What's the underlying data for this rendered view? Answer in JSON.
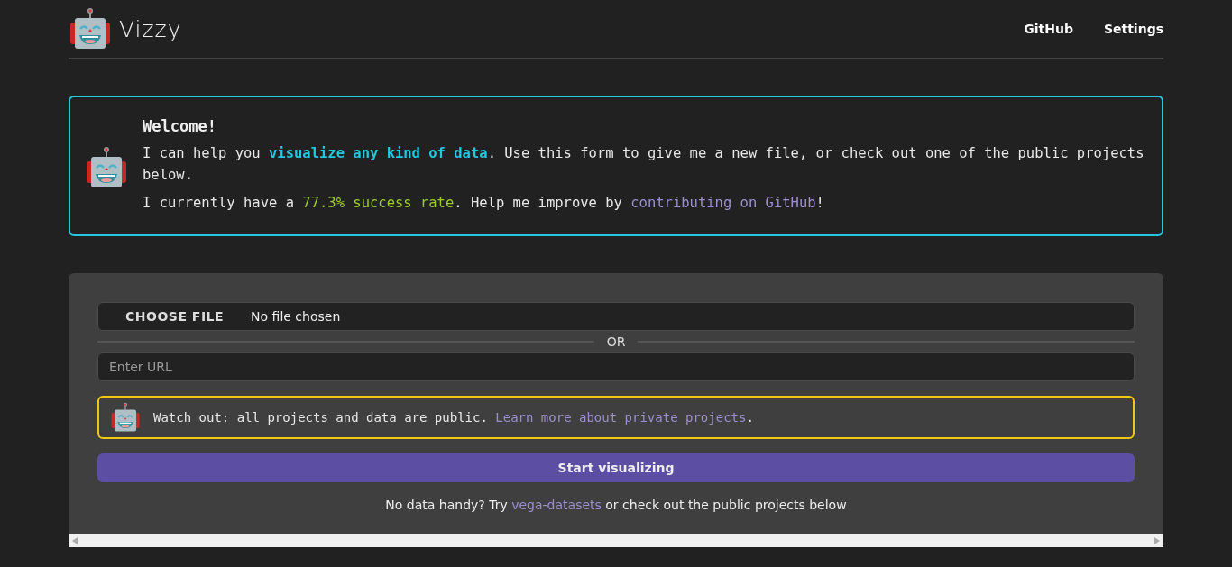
{
  "header": {
    "brand": "Vizzy",
    "nav": [
      "GitHub",
      "Settings"
    ]
  },
  "welcome": {
    "title": "Welcome!",
    "paragraphs": [
      [
        {
          "kind": "plain",
          "text": "I can help you "
        },
        {
          "kind": "highlight",
          "text": "visualize any kind of data"
        },
        {
          "kind": "plain",
          "text": ". Use this form to give me a new file, or check out one of the public projects below."
        }
      ],
      [
        {
          "kind": "plain",
          "text": "I currently have a "
        },
        {
          "kind": "success",
          "text": "77.3% success rate"
        },
        {
          "kind": "plain",
          "text": ". Help me improve by "
        },
        {
          "kind": "link",
          "text": "contributing on GitHub"
        },
        {
          "kind": "plain",
          "text": "!"
        }
      ]
    ]
  },
  "form": {
    "file_button": "CHOOSE FILE",
    "file_status": "No file chosen",
    "divider": "OR",
    "url": {
      "placeholder": "Enter URL"
    },
    "warning": [
      {
        "kind": "plain",
        "text": "Watch out: all projects and data are public. "
      },
      {
        "kind": "link",
        "text": "Learn more about private projects"
      },
      {
        "kind": "plain",
        "text": "."
      }
    ],
    "submit": "Start visualizing",
    "footer": [
      {
        "kind": "plain",
        "text": "No data handy? Try "
      },
      {
        "kind": "link",
        "text": "vega-datasets"
      },
      {
        "kind": "plain",
        "text": " or check out the public projects below"
      }
    ]
  }
}
